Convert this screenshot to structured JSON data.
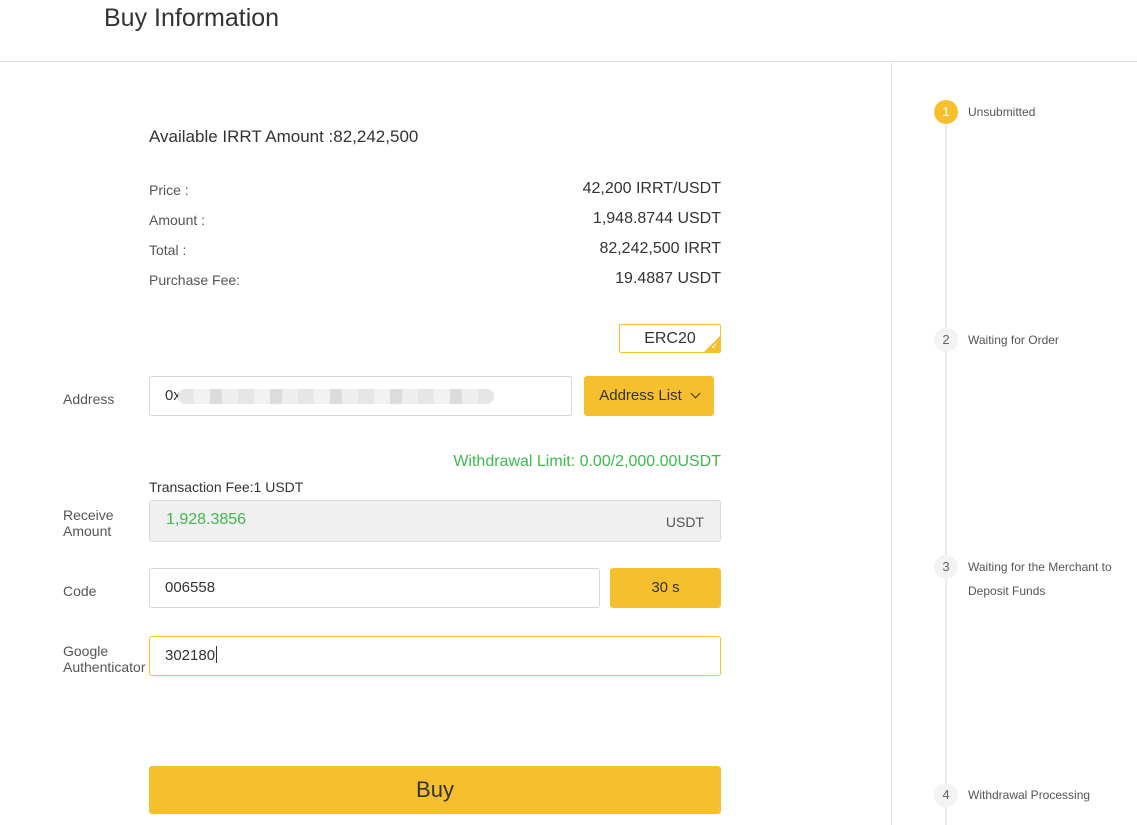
{
  "header": {
    "title": "Buy Information"
  },
  "summary": {
    "available": "Available IRRT Amount :82,242,500",
    "rows": [
      {
        "label": "Price :",
        "value": "42,200 IRRT/USDT"
      },
      {
        "label": "Amount :",
        "value": "1,948.8744 USDT"
      },
      {
        "label": "Total :",
        "value": "82,242,500 IRRT"
      },
      {
        "label": "Purchase Fee:",
        "value": "19.4887 USDT"
      }
    ]
  },
  "chain": {
    "selected": "ERC20",
    "check_icon": "checkmark-icon"
  },
  "address": {
    "label": "Address",
    "value": "0x",
    "list_button": "Address List",
    "chevron_icon": "chevron-down-icon"
  },
  "withdrawal_limit": "Withdrawal Limit: 0.00/2,000.00USDT",
  "transaction_fee": "Transaction Fee:1 USDT",
  "receive": {
    "label_line1": "Receive",
    "label_line2": "Amount",
    "value": "1,928.3856",
    "unit": "USDT"
  },
  "code": {
    "label": "Code",
    "value": "006558",
    "button": "30 s"
  },
  "google_auth": {
    "label_line1": "Google",
    "label_line2": "Authenticator",
    "value": "302180"
  },
  "buy_button": "Buy",
  "steps": [
    {
      "number": "1",
      "label": "Unsubmitted",
      "active": true
    },
    {
      "number": "2",
      "label": "Waiting for Order",
      "active": false
    },
    {
      "number": "3",
      "label_line1": "Waiting for the Merchant to",
      "label_line2": "Deposit Funds",
      "active": false
    },
    {
      "number": "4",
      "label": "Withdrawal Processing",
      "active": false
    }
  ],
  "colors": {
    "accent": "#f5bf2e",
    "success": "#3dba4e",
    "text": "#333333",
    "border": "#d6d6d6"
  }
}
